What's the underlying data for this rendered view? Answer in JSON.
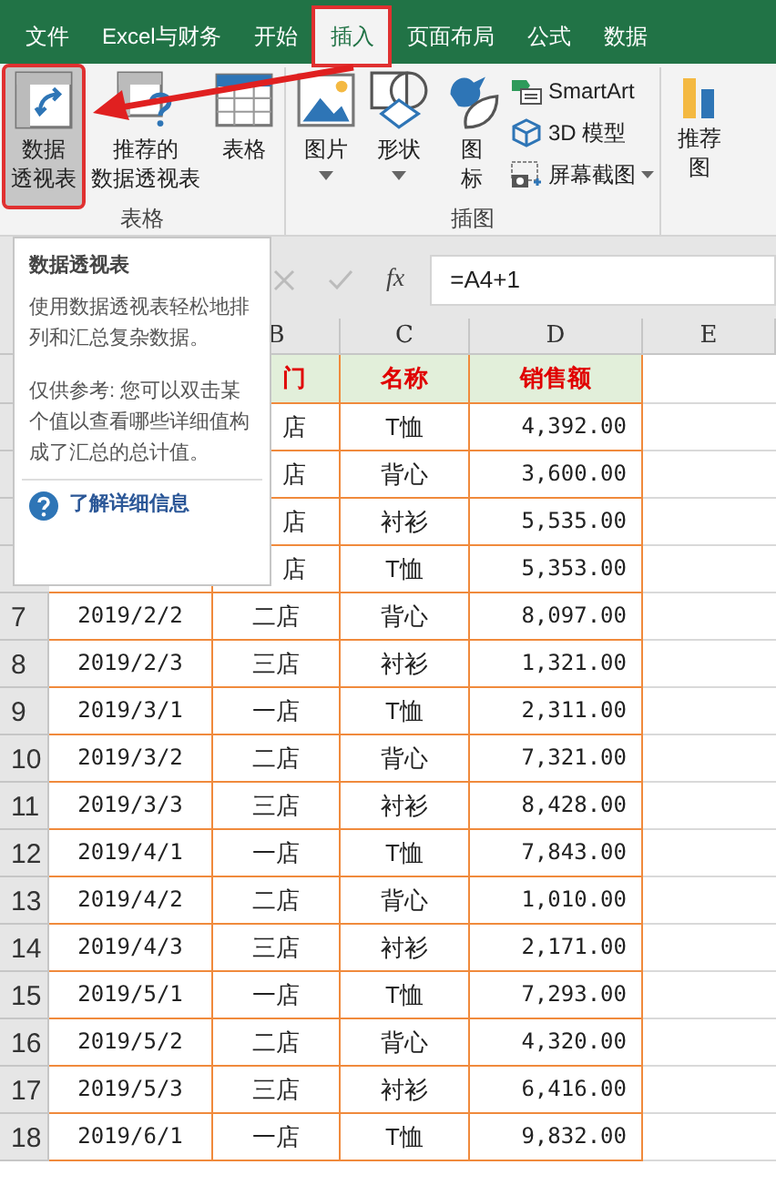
{
  "tabs": [
    {
      "label": "文件",
      "selected": false
    },
    {
      "label": "Excel与财务",
      "selected": false
    },
    {
      "label": "开始",
      "selected": false
    },
    {
      "label": "插入",
      "selected": true
    },
    {
      "label": "页面布局",
      "selected": false
    },
    {
      "label": "公式",
      "selected": false
    },
    {
      "label": "数据",
      "selected": false
    }
  ],
  "ribbon": {
    "groups": [
      {
        "kind": "table",
        "title": "表格",
        "buttons": [
          {
            "lines": [
              "数据",
              "透视表"
            ],
            "selected": true
          },
          {
            "lines": [
              "推荐的",
              "数据透视表"
            ],
            "selected": false
          },
          {
            "lines": [
              "表格"
            ],
            "selected": false
          }
        ]
      },
      {
        "kind": "illustrations",
        "title": "插图",
        "buttons": [
          {
            "lines": [
              "图片"
            ],
            "dropdown": true
          },
          {
            "lines": [
              "形状"
            ],
            "dropdown": true
          },
          {
            "lines": [
              "图",
              "标"
            ],
            "dropdown": false
          }
        ],
        "small": [
          {
            "label": "SmartArt",
            "dropdown": false
          },
          {
            "label": "3D 模型",
            "dropdown": false
          },
          {
            "label": "屏幕截图",
            "dropdown": true
          }
        ]
      },
      {
        "kind": "cut",
        "buttons": [
          {
            "lines": [
              "推荐",
              "图"
            ]
          }
        ]
      }
    ]
  },
  "tooltip": {
    "title": "数据透视表",
    "description": "使用数据透视表轻松地排列和汇总复杂数据。",
    "note": "仅供参考: 您可以双击某个值以查看哪些详细值构成了汇总的总计值。",
    "link": "了解详细信息"
  },
  "formula_bar": {
    "fx": "fx",
    "formula": "=A4+1"
  },
  "sheet": {
    "columns": [
      "B",
      "C",
      "D",
      "E"
    ],
    "header": [
      "门",
      "名称",
      "销售额"
    ],
    "rows": [
      {
        "dept": "店",
        "name": "T恤",
        "amount": "4,392.00"
      },
      {
        "dept": "店",
        "name": "背心",
        "amount": "3,600.00"
      },
      {
        "dept": "店",
        "name": "衬衫",
        "amount": "5,535.00"
      },
      {
        "dept": "店",
        "name": "T恤",
        "amount": "5,353.00"
      },
      {
        "number": "7",
        "date": "2019/2/2",
        "dept": "二店",
        "name": "背心",
        "amount": "8,097.00"
      },
      {
        "number": "8",
        "date": "2019/2/3",
        "dept": "三店",
        "name": "衬衫",
        "amount": "1,321.00"
      },
      {
        "number": "9",
        "date": "2019/3/1",
        "dept": "一店",
        "name": "T恤",
        "amount": "2,311.00"
      },
      {
        "number": "10",
        "date": "2019/3/2",
        "dept": "二店",
        "name": "背心",
        "amount": "7,321.00"
      },
      {
        "number": "11",
        "date": "2019/3/3",
        "dept": "三店",
        "name": "衬衫",
        "amount": "8,428.00"
      },
      {
        "number": "12",
        "date": "2019/4/1",
        "dept": "一店",
        "name": "T恤",
        "amount": "7,843.00"
      },
      {
        "number": "13",
        "date": "2019/4/2",
        "dept": "二店",
        "name": "背心",
        "amount": "1,010.00"
      },
      {
        "number": "14",
        "date": "2019/4/3",
        "dept": "三店",
        "name": "衬衫",
        "amount": "2,171.00"
      },
      {
        "number": "15",
        "date": "2019/5/1",
        "dept": "一店",
        "name": "T恤",
        "amount": "7,293.00"
      },
      {
        "number": "16",
        "date": "2019/5/2",
        "dept": "二店",
        "name": "背心",
        "amount": "4,320.00"
      },
      {
        "number": "17",
        "date": "2019/5/3",
        "dept": "三店",
        "name": "衬衫",
        "amount": "6,416.00"
      },
      {
        "number": "18",
        "date": "2019/6/1",
        "dept": "一店",
        "name": "T恤",
        "amount": "9,832.00"
      }
    ]
  }
}
